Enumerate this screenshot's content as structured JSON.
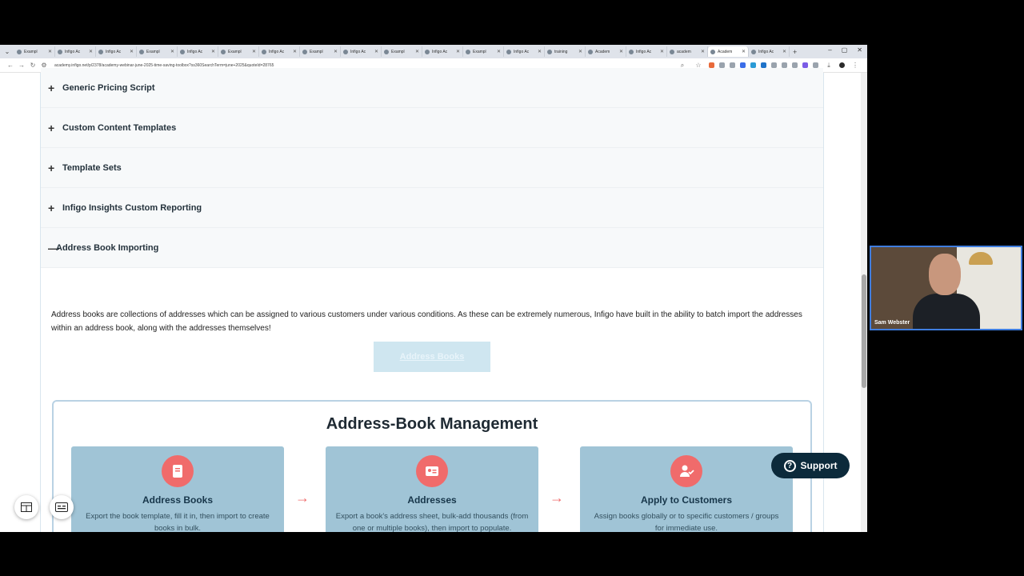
{
  "browser": {
    "tabs": [
      {
        "label": "Exampl"
      },
      {
        "label": "Infigo Ac"
      },
      {
        "label": "Infigo Ac"
      },
      {
        "label": "Exampl"
      },
      {
        "label": "Infigo Ac"
      },
      {
        "label": "Exampl"
      },
      {
        "label": "Infigo Ac"
      },
      {
        "label": "Exampl"
      },
      {
        "label": "Infigo Ac"
      },
      {
        "label": "Exampl"
      },
      {
        "label": "Infigo Ac"
      },
      {
        "label": "Exampl"
      },
      {
        "label": "Infigo Ac"
      },
      {
        "label": "training"
      },
      {
        "label": "Academ"
      },
      {
        "label": "Infigo Ac"
      },
      {
        "label": "academ"
      },
      {
        "label": "Academ"
      },
      {
        "label": "Infigo Ac"
      }
    ],
    "active_tab_index": 17,
    "url": "academy.infigo.net/p/2378/academy-webinar-june-2025-time-saving-toolbox?ss360SearchTerm=june+2025&quoteId=28765"
  },
  "accordion": {
    "items": [
      {
        "label": "Generic Pricing Script",
        "icon": "+"
      },
      {
        "label": "Custom Content Templates",
        "icon": "+"
      },
      {
        "label": "Template Sets",
        "icon": "+"
      },
      {
        "label": "Infigo Insights Custom Reporting",
        "icon": "+"
      },
      {
        "label": "Address Book Importing",
        "icon": "—"
      }
    ],
    "open_body": "Address books are collections of addresses which can be assigned to various customers under various conditions. As these can be extremely numerous, Infigo have built in the ability to batch import the addresses within an address book, along with the addresses themselves!",
    "button_label": "Address Books"
  },
  "infographic": {
    "title": "Address-Book Management",
    "cards": [
      {
        "title": "Address Books",
        "desc": "Export the book template, fill it in, then import to create books in bulk.",
        "icon": "book-icon"
      },
      {
        "title": "Addresses",
        "desc": "Export a book's address sheet, bulk-add thousands (from one or multiple books), then import to populate.",
        "icon": "address-card-icon"
      },
      {
        "title": "Apply to Customers",
        "desc": "Assign books globally or to specific customers / groups for immediate use.",
        "icon": "user-check-icon"
      }
    ],
    "arrow": "→",
    "accent": "#f06b6b",
    "card_bg": "#a0c4d6"
  },
  "widgets": {
    "support_label": "Support",
    "support_icon": "?"
  },
  "webcam": {
    "name": "Sam Webster"
  }
}
